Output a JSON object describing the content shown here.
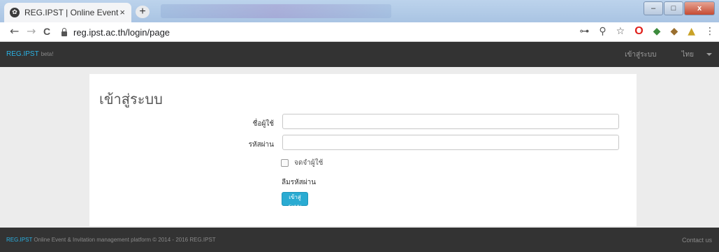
{
  "browser": {
    "tab_title": "REG.IPST | Online Event & Invitat",
    "tab_close": "×",
    "new_tab": "+",
    "url": "reg.ipst.ac.th/login/page",
    "window_controls": {
      "minimize": "–",
      "maximize": "□",
      "close": "x"
    },
    "nav": {
      "back": "←",
      "forward": "→",
      "reload": "C"
    },
    "toolbar_icons": {
      "key": "⊶",
      "zoom": "⚲",
      "star": "☆",
      "opera": "O",
      "ext1": "◆",
      "ext2": "◆",
      "ext3": "▲",
      "menu": "⋮"
    }
  },
  "navbar": {
    "brand": "REG.IPST",
    "beta": "beta!",
    "login_link": "เข้าสู่ระบบ",
    "language": "ไทย"
  },
  "login": {
    "heading": "เข้าสู่ระบบ",
    "username_label": "ชื่อผู้ใช้",
    "username_value": "",
    "password_label": "รหัสผ่าน",
    "password_value": "",
    "remember_label": "จดจำผู้ใช้",
    "remember_checked": false,
    "forgot_label": "ลืมรหัสผ่าน",
    "submit_label": "เข้าสู่ระบบ"
  },
  "footer": {
    "brand": "REG.IPST",
    "text": " Online Event & Invitation management platform © 2014 - 2016 REG.IPST",
    "contact": "Contact us"
  },
  "colors": {
    "navbar_bg": "#333333",
    "brand": "#2ab3e6",
    "button": "#2aabd2",
    "page_bg": "#ececec"
  }
}
